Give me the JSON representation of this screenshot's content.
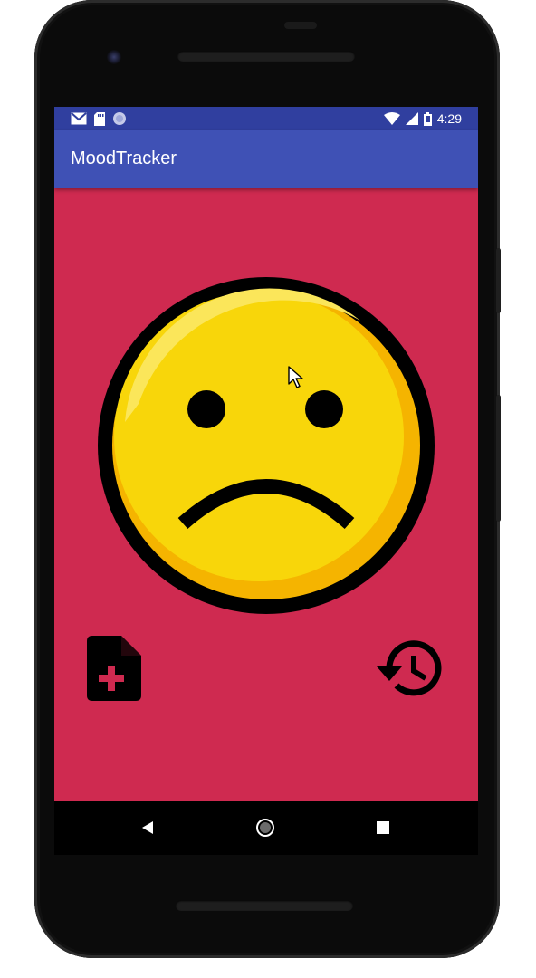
{
  "status_bar": {
    "time": "4:29",
    "left_icons": [
      "gmail-icon",
      "sd-card-icon",
      "sync-circle-icon"
    ],
    "right_icons": [
      "wifi-icon",
      "cell-signal-icon",
      "battery-icon"
    ],
    "color": "#303f9f"
  },
  "app_bar": {
    "title": "MoodTracker",
    "color": "#3f51b5"
  },
  "main": {
    "background": "#cf2a50",
    "mood_face": "sad-face-icon",
    "actions": [
      {
        "name": "add-note-button",
        "icon": "note-add-icon"
      },
      {
        "name": "history-button",
        "icon": "history-icon"
      }
    ]
  },
  "nav_bar": {
    "buttons": [
      "back-icon",
      "home-icon",
      "recents-icon"
    ]
  }
}
